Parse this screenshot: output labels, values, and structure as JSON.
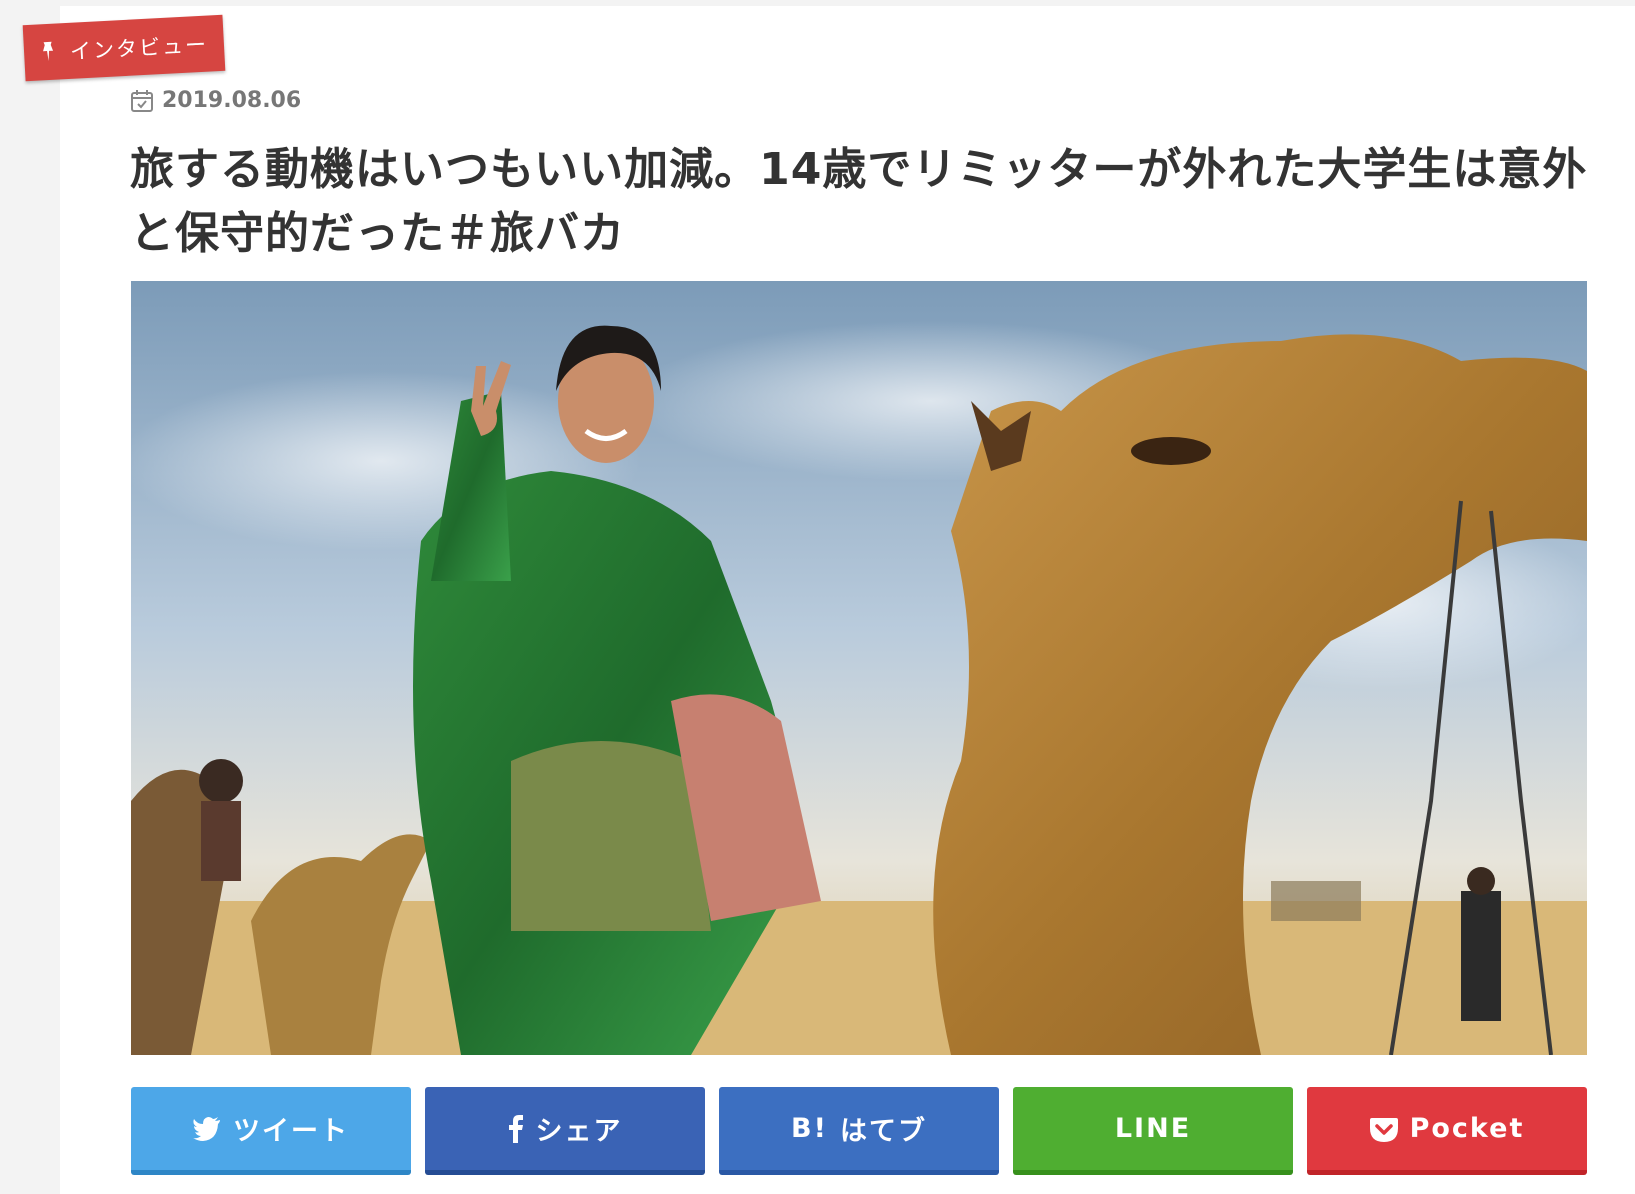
{
  "category": {
    "label": "インタビュー",
    "icon": "pin-icon"
  },
  "post": {
    "date": "2019.08.06",
    "date_icon": "calendar-icon",
    "title": "旅する動機はいつもいい加減。14歳でリミッターが外れた大学生は意外と保守的だった＃旅バカ"
  },
  "share": {
    "twitter": {
      "label": "ツイート",
      "icon": "twitter-bird-icon",
      "color": "#4da7e8"
    },
    "facebook": {
      "label": "シェア",
      "icon": "facebook-f-icon",
      "color": "#3a63b5"
    },
    "hatena": {
      "label": "はてブ",
      "icon_text": "B!",
      "icon": "hatena-bookmark-icon",
      "color": "#3c6fc1"
    },
    "line": {
      "label": "LINE",
      "color": "#4fae31"
    },
    "pocket": {
      "label": "Pocket",
      "icon": "pocket-icon",
      "color": "#e0393f"
    }
  },
  "colors": {
    "ribbon": "#d64541",
    "title_text": "#333333",
    "date_text": "#777777"
  }
}
